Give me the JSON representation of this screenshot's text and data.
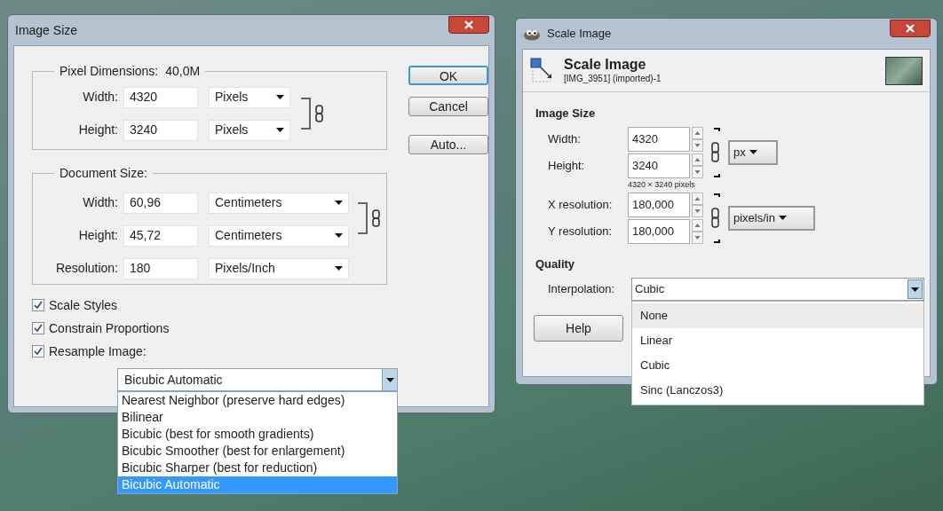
{
  "image_size_dialog": {
    "title": "Image Size",
    "pixel_dimensions": {
      "legend": "Pixel Dimensions:",
      "value": "40,0M",
      "rows": [
        {
          "label": "Width:",
          "value": "4320",
          "unit": "Pixels"
        },
        {
          "label": "Height:",
          "value": "3240",
          "unit": "Pixels"
        }
      ]
    },
    "document_size": {
      "legend": "Document Size:",
      "rows": [
        {
          "label": "Width:",
          "value": "60,96",
          "unit": "Centimeters"
        },
        {
          "label": "Height:",
          "value": "45,72",
          "unit": "Centimeters"
        },
        {
          "label": "Resolution:",
          "value": "180",
          "unit": "Pixels/Inch"
        }
      ]
    },
    "buttons": [
      {
        "label": "OK",
        "default": true
      },
      {
        "label": "Cancel",
        "default": false
      },
      {
        "label": "Auto...",
        "default": false
      }
    ],
    "checkboxes": [
      {
        "label": "Scale Styles",
        "checked": true
      },
      {
        "label": "Constrain Proportions",
        "checked": true
      },
      {
        "label": "Resample Image:",
        "checked": true
      }
    ],
    "resample": {
      "value": "Bicubic Automatic",
      "options": [
        {
          "label": "Nearest Neighbor (preserve hard edges)",
          "selected": false
        },
        {
          "label": "Bilinear",
          "selected": false
        },
        {
          "label": "Bicubic (best for smooth gradients)",
          "selected": false
        },
        {
          "label": "Bicubic Smoother (best for enlargement)",
          "selected": false
        },
        {
          "label": "Bicubic Sharper (best for reduction)",
          "selected": false
        },
        {
          "label": "Bicubic Automatic",
          "selected": true
        }
      ]
    }
  },
  "scale_image_dialog": {
    "title": "Scale Image",
    "header": {
      "title": "Scale Image",
      "subtitle": "[IMG_3951] (imported)-1"
    },
    "image_size": {
      "heading": "Image Size",
      "size_rows": [
        {
          "label": "Width:",
          "value": "4320"
        },
        {
          "label": "Height:",
          "value": "3240"
        }
      ],
      "size_unit": "px",
      "pixel_note": "4320 × 3240 pixels",
      "resolution_rows": [
        {
          "label": "X resolution:",
          "value": "180,000"
        },
        {
          "label": "Y resolution:",
          "value": "180,000"
        }
      ],
      "resolution_unit": "pixels/in"
    },
    "quality": {
      "heading": "Quality",
      "label": "Interpolation:",
      "value": "Cubic",
      "options": [
        {
          "label": "None",
          "hovered": true
        },
        {
          "label": "Linear",
          "hovered": false
        },
        {
          "label": "Cubic",
          "hovered": false
        },
        {
          "label": "Sinc (Lanczos3)",
          "hovered": false
        }
      ]
    },
    "buttons": [
      {
        "label": "Help"
      }
    ]
  }
}
